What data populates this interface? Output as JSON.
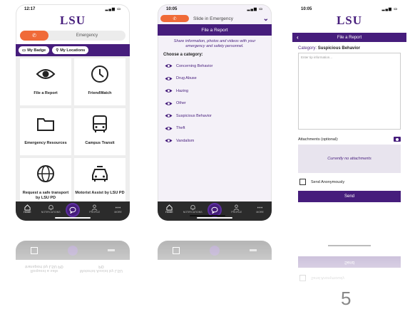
{
  "phone1": {
    "time": "12:17",
    "logo": "LSU",
    "toggle_label": "Emergency",
    "badge_label": "My Badge",
    "locations_label": "My Locations",
    "tiles": [
      {
        "label": "File a Report",
        "icon": "eye-icon"
      },
      {
        "label": "FriendWatch",
        "icon": "clock-icon"
      },
      {
        "label": "Emergency Resources",
        "icon": "folder-icon"
      },
      {
        "label": "Campus Transit",
        "icon": "bus-icon"
      },
      {
        "label": "Request a safe transport by LSU PD",
        "icon": "globe-icon"
      },
      {
        "label": "Motorist Assist by LSU PD",
        "icon": "car-icon"
      }
    ],
    "nav": [
      "HOME",
      "NOTIFICATIONS",
      "",
      "PROFILE",
      "MORE"
    ]
  },
  "phone2": {
    "time": "10:05",
    "slide_label": "Slide in Emergency",
    "header": "File a Report",
    "intro": "Share information, photos and videos with your emergency and safety personnel.",
    "choose_label": "Choose a category:",
    "categories": [
      "Concerning Behavior",
      "Drug Abuse",
      "Hazing",
      "Other",
      "Suspicious Behavior",
      "Theft",
      "Vandalism"
    ],
    "nav": [
      "HOME",
      "NOTIFICATIONS",
      "",
      "PROFILE",
      "MORE"
    ]
  },
  "phone3": {
    "time": "10:05",
    "logo": "LSU",
    "header": "File a Report",
    "category_prefix": "Category:",
    "category_value": "Suspicious Behavior",
    "tip_placeholder": "Enter tip information...",
    "attachments_label": "Attachments (optional):",
    "no_attachments": "Currently no attachments",
    "anon_label": "Send Anonymously",
    "send_label": "Send"
  },
  "page_number": "5",
  "colors": {
    "lsu_purple": "#461d7c",
    "accent_orange": "#f06a38",
    "nav_dark": "#2b2b2b"
  }
}
